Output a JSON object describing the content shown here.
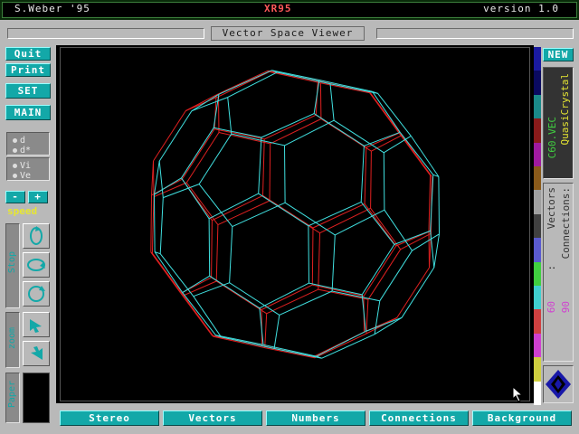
{
  "header": {
    "author": "S.Weber '95",
    "app_title": "XR95",
    "version": "version 1.0",
    "viewer_label": "Vector Space Viewer"
  },
  "left_menu": {
    "quit": "Quit",
    "print": "Print",
    "set": "SET",
    "main": "MAIN",
    "options": [
      "d",
      "d*",
      "Vi",
      "Ve"
    ],
    "minus": "-",
    "plus": "+",
    "speed_label": "speed",
    "stop_label": "Stop",
    "zoom_label": "zoom",
    "paper_label": "Paper"
  },
  "right_panel": {
    "new_button": "NEW",
    "file_name": "C60.VEC",
    "object_name": "QuasiCrystal",
    "vectors_label": "Vectors",
    "vectors_count": "60",
    "connections_label": "Connections:",
    "connections_count": "90",
    "color_strip": [
      "#1a1aa0",
      "#0a0a60",
      "#1a8a8a",
      "#8a1a1a",
      "#a01aa0",
      "#8a5a1a",
      "#a0a0a0",
      "#404040",
      "#5a5ad0",
      "#40d040",
      "#40d0d0",
      "#d04040",
      "#d040d0",
      "#d0d040",
      "#ffffff"
    ]
  },
  "bottom_tabs": [
    "Stereo",
    "Vectors",
    "Numbers",
    "Connections",
    "Background"
  ],
  "colors": {
    "teal": "#13a8a8",
    "panel_gray": "#b9b9b9",
    "title_red": "#ff5a5a",
    "wire_cyan": "#40e0e0",
    "wire_red": "#e02020",
    "label_yellow": "#e6e633"
  }
}
